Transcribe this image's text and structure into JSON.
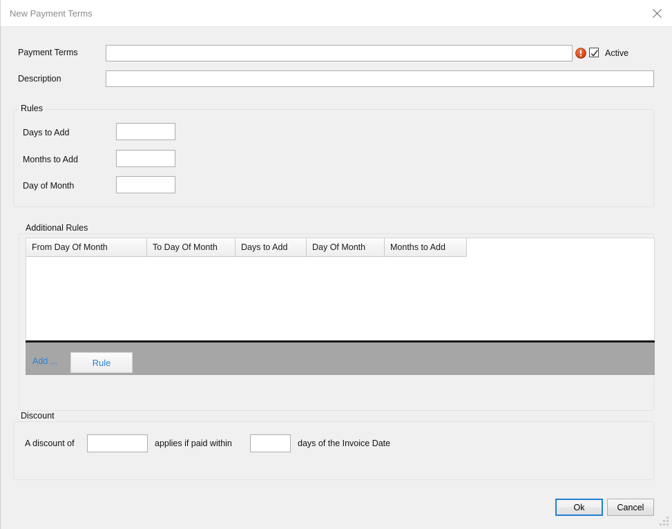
{
  "window": {
    "title": "New Payment Terms",
    "close_icon": "close-icon",
    "resize_grip": "resize-grip"
  },
  "form": {
    "payment_terms": {
      "label": "Payment Terms",
      "value": "",
      "placeholder": ""
    },
    "description": {
      "label": "Description",
      "value": "",
      "placeholder": ""
    },
    "error_icon": "error-exclamation-icon",
    "active": {
      "label": "Active",
      "checked": true
    }
  },
  "rules": {
    "title": "Rules",
    "fields": [
      {
        "label": "Days to Add",
        "value": ""
      },
      {
        "label": "Months to Add",
        "value": ""
      },
      {
        "label": "Day of Month",
        "value": ""
      }
    ]
  },
  "additional_rules": {
    "title": "Additional Rules",
    "columns": [
      "From Day Of Month",
      "To Day Of Month",
      "Days to Add",
      "Day Of Month",
      "Months to Add"
    ],
    "rows": [],
    "toolbar": {
      "add_label": "Add ...",
      "rule_label": "Rule"
    }
  },
  "discount": {
    "title": "Discount",
    "text_before": "A discount of",
    "amount_value": "",
    "text_middle": "applies if paid within",
    "days_value": "",
    "text_after": "days of the Invoice Date"
  },
  "footer": {
    "ok_label": "Ok",
    "cancel_label": "Cancel"
  },
  "colors": {
    "accent": "#2b7fd4",
    "error": "#d9461f",
    "toolbar_gray": "#a6a6a6",
    "body_bg": "#f0f0f0"
  }
}
